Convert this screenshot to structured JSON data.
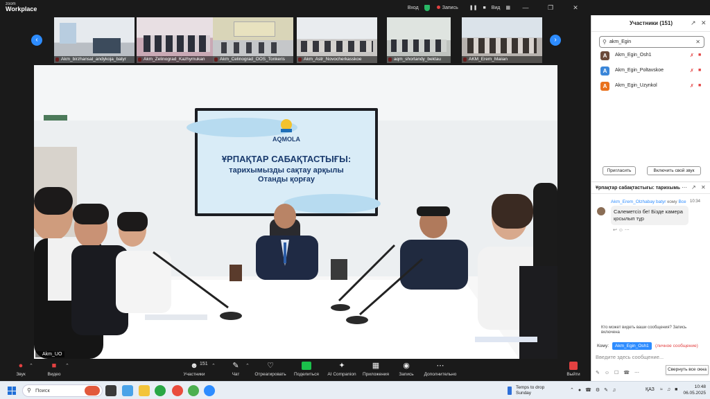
{
  "app": {
    "logo_top": "zoom",
    "logo_bottom": "Workplace"
  },
  "titlebar": {
    "signin": "Вход",
    "record": "Запись",
    "view": "Вид"
  },
  "thumbnails": [
    {
      "name": "Akm_birzhansal_andykoja_batyr"
    },
    {
      "name": "Akm_Zelinograd_Kazhymukan"
    },
    {
      "name": "Akm_Celinograd_OOS_Tonkeris"
    },
    {
      "name": "Akm_Astr_Novocherkasskoe"
    },
    {
      "name": "aqm_shortandy_bektau"
    },
    {
      "name": "AKM_Erem_Maiian"
    }
  ],
  "main_video": {
    "speaker_name": "Akm_UO",
    "screen_brand": "AQMOLA",
    "screen_title": "ҰРПАҚТАР САБАҚТАСТЫҒЫ:",
    "screen_sub1": "тарихымызды сақтау арқылы",
    "screen_sub2": "Отанды қорғау"
  },
  "toolbar": {
    "audio": "Звук",
    "video": "Видео",
    "participants": "Участники",
    "participants_count": "151",
    "chat": "Чат",
    "react": "Отреагировать",
    "share": "Поделиться",
    "ai": "AI Companion",
    "apps": "Приложения",
    "record": "Запись",
    "more": "Дополнительно",
    "leave": "Выйти"
  },
  "participants_panel": {
    "title": "Участники (151)",
    "search_value": "akm_Egin",
    "list": [
      {
        "initial": "A",
        "name": "Akm_Egin_Osh1",
        "color": "#6b4a3a"
      },
      {
        "initial": "A",
        "name": "Akm_Egin_Poltavskoe",
        "color": "#3b86d8"
      },
      {
        "initial": "A",
        "name": "Akm_Egin_Uzynkol",
        "color": "#e9711c"
      }
    ],
    "invite": "Пригласить",
    "unmute_self": "Включить свой звук"
  },
  "chat_panel": {
    "title": "Ұрпақтар сабақтастығы: тарихымызды сақтау арқылы Отанды қорғау",
    "message": {
      "sender": "Akm_Erem_Olzhabay batyr",
      "to_word": "кому",
      "to": "Все",
      "time": "10:34",
      "text": "Салеметсіз бе! Бізде камера қосылып тұр"
    },
    "visibility_note": "Кто может видеть ваши сообщения? Запись включена",
    "to_label": "Кому:",
    "to_selected": "Akm_Egin_Osh1",
    "private_label": "(личное сообщение)",
    "input_placeholder": "Введите здесь сообщение...",
    "collapse_tooltip": "Свернуть все окна"
  },
  "taskbar": {
    "search": "Поиск",
    "weather_line1": "Temps to drop",
    "weather_line2": "Sunday",
    "lang": "ҚАЗ",
    "time": "10:48",
    "date": "06.05.2025"
  },
  "colors": {
    "accent": "#2d8cff",
    "danger": "#e34141",
    "share": "#1bbf4b"
  }
}
